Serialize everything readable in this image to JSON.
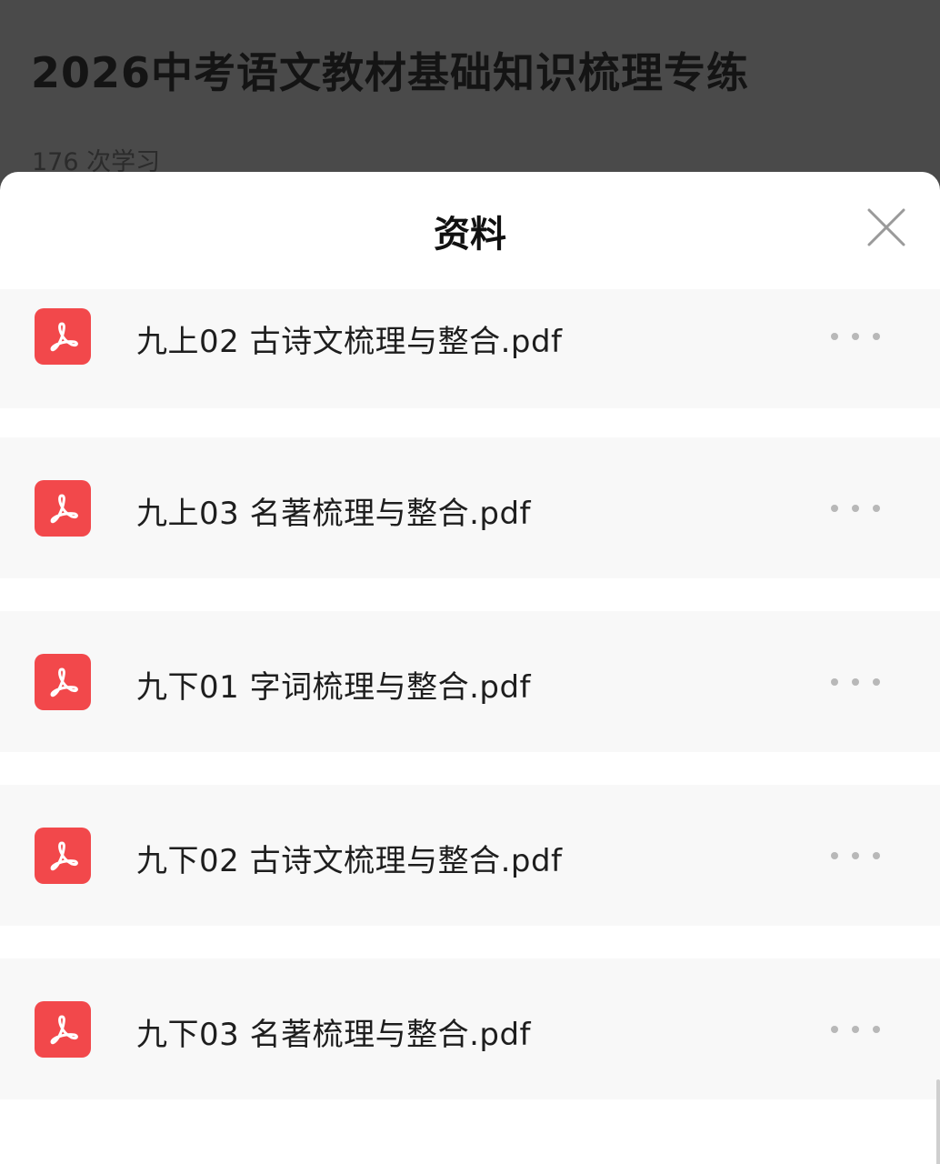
{
  "background_page": {
    "title": "2026中考语文教材基础知识梳理专练",
    "study_count": "176 次学习"
  },
  "sheet": {
    "title": "资料",
    "close_icon": "close-icon"
  },
  "files": [
    {
      "name": "九上02 古诗文梳理与整合.pdf",
      "icon": "pdf-icon"
    },
    {
      "name": "九上03 名著梳理与整合.pdf",
      "icon": "pdf-icon"
    },
    {
      "name": "九下01 字词梳理与整合.pdf",
      "icon": "pdf-icon"
    },
    {
      "name": "九下02 古诗文梳理与整合.pdf",
      "icon": "pdf-icon"
    },
    {
      "name": "九下03 名著梳理与整合.pdf",
      "icon": "pdf-icon"
    }
  ],
  "colors": {
    "pdf_icon_bg": "#f2484b",
    "row_bg": "#f8f8f8",
    "overlay": "#4a4a4a"
  }
}
